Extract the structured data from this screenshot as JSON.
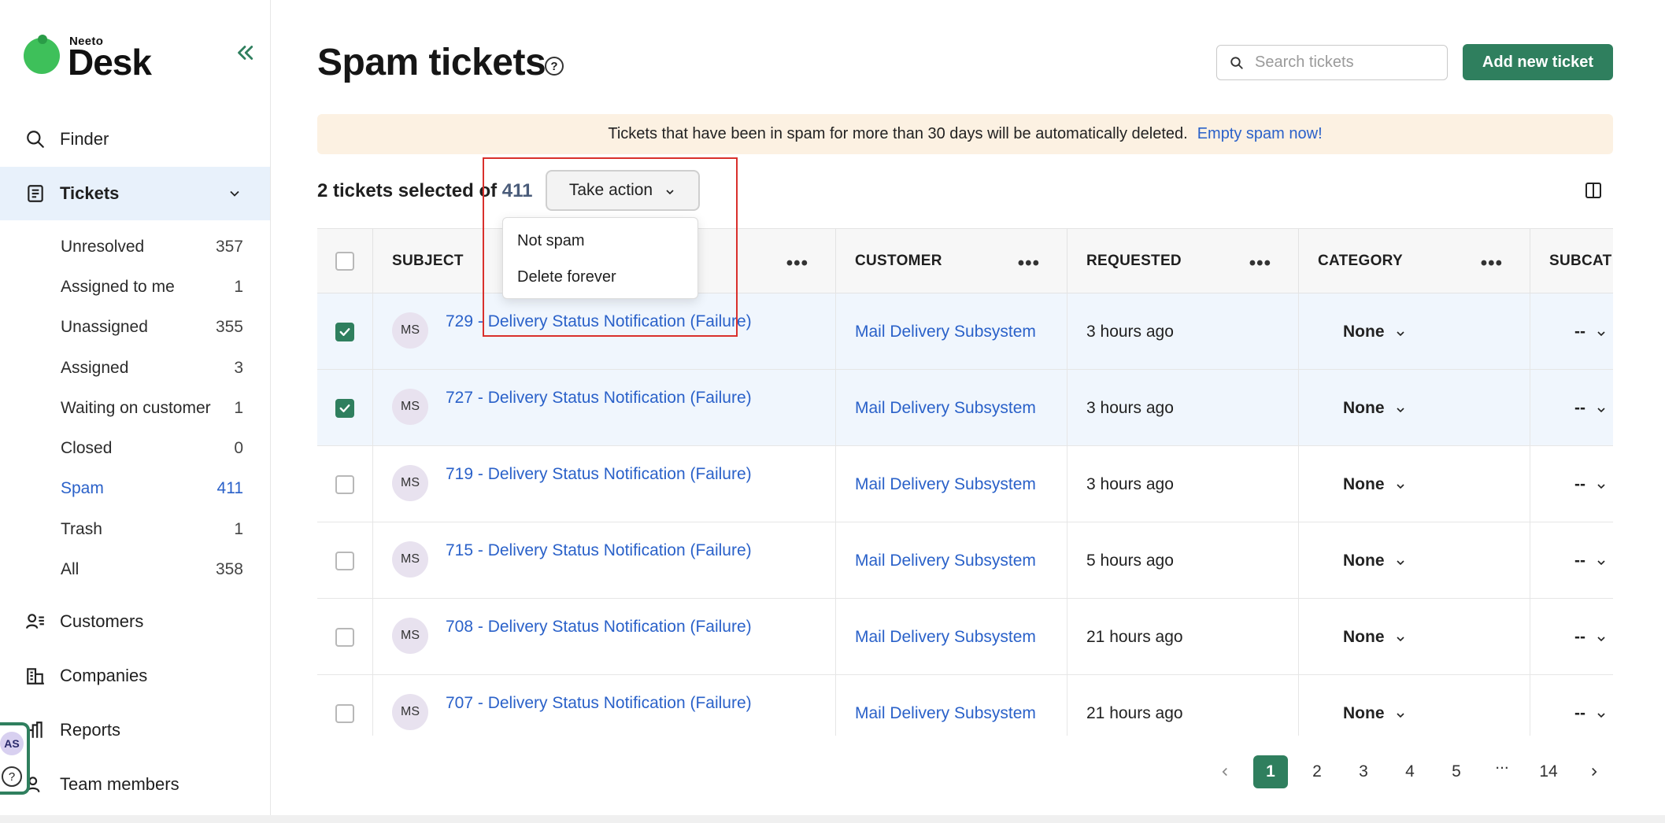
{
  "brand": {
    "small": "Neeto",
    "big": "Desk"
  },
  "sidebar": {
    "nav": [
      {
        "label": "Finder",
        "icon": "search-icon"
      },
      {
        "label": "Tickets",
        "icon": "tickets-icon"
      },
      {
        "label": "Customers",
        "icon": "customers-icon"
      },
      {
        "label": "Companies",
        "icon": "companies-icon"
      },
      {
        "label": "Reports",
        "icon": "reports-icon"
      },
      {
        "label": "Team members",
        "icon": "team-members-icon"
      }
    ],
    "ticket_views": [
      {
        "label": "Unresolved",
        "count": "357"
      },
      {
        "label": "Assigned to me",
        "count": "1"
      },
      {
        "label": "Unassigned",
        "count": "355"
      },
      {
        "label": "Assigned",
        "count": "3"
      },
      {
        "label": "Waiting on customer",
        "count": "1"
      },
      {
        "label": "Closed",
        "count": "0"
      },
      {
        "label": "Spam",
        "count": "411"
      },
      {
        "label": "Trash",
        "count": "1"
      },
      {
        "label": "All",
        "count": "358"
      }
    ],
    "user_initials": "AS"
  },
  "header": {
    "title": "Spam tickets",
    "search_placeholder": "Search tickets",
    "add_button": "Add new ticket"
  },
  "banner": {
    "text": "Tickets that have been in spam for more than 30 days will be automatically deleted.",
    "link": "Empty spam now!"
  },
  "selection": {
    "prefix": "2 tickets selected of",
    "total": "411",
    "action_button": "Take action",
    "menu": [
      "Not spam",
      "Delete forever"
    ]
  },
  "table": {
    "columns": [
      "SUBJECT",
      "CUSTOMER",
      "REQUESTED",
      "CATEGORY",
      "SUBCAT"
    ],
    "rows": [
      {
        "checked": true,
        "initials": "MS",
        "subject": "729 - Delivery Status Notification (Failure)",
        "customer": "Mail Delivery Subsystem",
        "requested": "3 hours ago",
        "category": "None",
        "subcategory": "--"
      },
      {
        "checked": true,
        "initials": "MS",
        "subject": "727 - Delivery Status Notification (Failure)",
        "customer": "Mail Delivery Subsystem",
        "requested": "3 hours ago",
        "category": "None",
        "subcategory": "--"
      },
      {
        "checked": false,
        "initials": "MS",
        "subject": "719 - Delivery Status Notification (Failure)",
        "customer": "Mail Delivery Subsystem",
        "requested": "3 hours ago",
        "category": "None",
        "subcategory": "--"
      },
      {
        "checked": false,
        "initials": "MS",
        "subject": "715 - Delivery Status Notification (Failure)",
        "customer": "Mail Delivery Subsystem",
        "requested": "5 hours ago",
        "category": "None",
        "subcategory": "--"
      },
      {
        "checked": false,
        "initials": "MS",
        "subject": "708 - Delivery Status Notification (Failure)",
        "customer": "Mail Delivery Subsystem",
        "requested": "21 hours ago",
        "category": "None",
        "subcategory": "--"
      },
      {
        "checked": false,
        "initials": "MS",
        "subject": "707 - Delivery Status Notification (Failure)",
        "customer": "Mail Delivery Subsystem",
        "requested": "21 hours ago",
        "category": "None",
        "subcategory": "--"
      }
    ]
  },
  "pagination": {
    "pages": [
      "1",
      "2",
      "3",
      "4",
      "5",
      "...",
      "14"
    ],
    "current": "1"
  },
  "colors": {
    "primary": "#2f7f5e",
    "link": "#2a61c9",
    "banner_bg": "#fcf1e2",
    "selected_row": "#f0f6fd",
    "highlight": "#d9302c"
  }
}
